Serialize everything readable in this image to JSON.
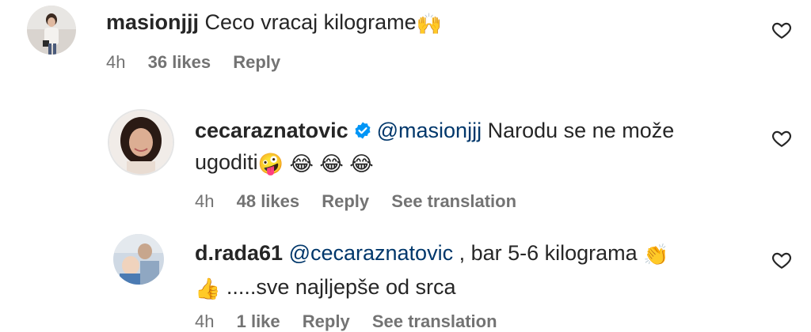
{
  "comments": [
    {
      "username": "masionjjj",
      "text": "Ceco vracaj kilograme",
      "emoji": "🙌",
      "time": "4h",
      "likes": "36 likes",
      "reply": "Reply"
    },
    {
      "username": "cecaraznatovic",
      "mention": "@masionjjj",
      "text_line1": "Narodu se ne može",
      "text_line2": "ugoditi",
      "emojis": [
        "🤪",
        "😂",
        "😂",
        "😂"
      ],
      "time": "4h",
      "likes": "48 likes",
      "reply": "Reply",
      "translate": "See translation"
    },
    {
      "username": "d.rada61",
      "mention": "@cecaraznatovic",
      "text_line1": ", bar 5-6 kilograma",
      "emoji1": "👏",
      "emoji2": "👍",
      "text_line2": ".....sve najljepše od srca",
      "time": "4h",
      "likes": "1 like",
      "reply": "Reply",
      "translate": "See translation"
    }
  ],
  "icons": {
    "heart": "heart-outline-icon",
    "verified": "verified-badge-icon"
  },
  "colors": {
    "text": "#262626",
    "meta": "#737373",
    "mention": "#00376b",
    "verified": "#0095f6"
  }
}
